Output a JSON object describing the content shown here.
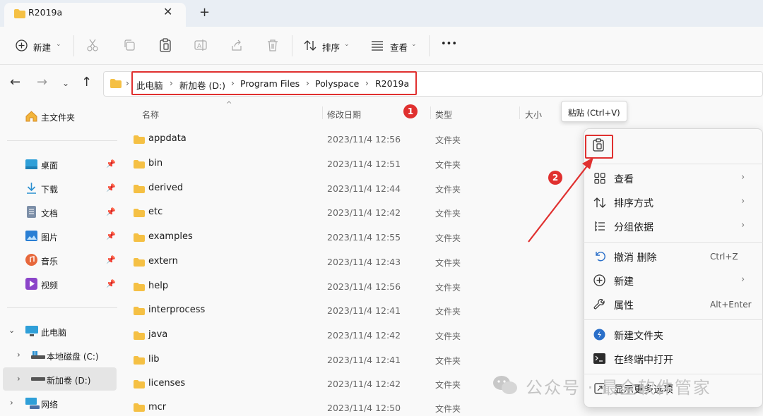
{
  "window": {
    "tab_title": "R2019a",
    "new_tab": "+",
    "close_tab": "✕"
  },
  "toolbar": {
    "new_label": "新建",
    "sort_label": "排序",
    "view_label": "查看",
    "more": "•••"
  },
  "breadcrumb": [
    "此电脑",
    "新加卷 (D:)",
    "Program Files",
    "Polyspace",
    "R2019a"
  ],
  "sidebar": {
    "home": "主文件夹",
    "quick": [
      {
        "label": "桌面",
        "icon": "desktop-icon"
      },
      {
        "label": "下载",
        "icon": "download-icon"
      },
      {
        "label": "文档",
        "icon": "document-icon"
      },
      {
        "label": "图片",
        "icon": "pictures-icon"
      },
      {
        "label": "音乐",
        "icon": "music-icon"
      },
      {
        "label": "视频",
        "icon": "video-icon"
      }
    ],
    "this_pc": "此电脑",
    "drives": [
      {
        "label": "本地磁盘 (C:)"
      },
      {
        "label": "新加卷 (D:)"
      }
    ],
    "network": "网络"
  },
  "columns": {
    "name": "名称",
    "date": "修改日期",
    "type": "类型",
    "size": "大小"
  },
  "files": [
    {
      "name": "appdata",
      "date": "2023/11/4 12:56",
      "type": "文件夹"
    },
    {
      "name": "bin",
      "date": "2023/11/4 12:51",
      "type": "文件夹"
    },
    {
      "name": "derived",
      "date": "2023/11/4 12:44",
      "type": "文件夹"
    },
    {
      "name": "etc",
      "date": "2023/11/4 12:42",
      "type": "文件夹"
    },
    {
      "name": "examples",
      "date": "2023/11/4 12:55",
      "type": "文件夹"
    },
    {
      "name": "extern",
      "date": "2023/11/4 12:43",
      "type": "文件夹"
    },
    {
      "name": "help",
      "date": "2023/11/4 12:56",
      "type": "文件夹"
    },
    {
      "name": "interprocess",
      "date": "2023/11/4 12:41",
      "type": "文件夹"
    },
    {
      "name": "java",
      "date": "2023/11/4 12:42",
      "type": "文件夹"
    },
    {
      "name": "lib",
      "date": "2023/11/4 12:41",
      "type": "文件夹"
    },
    {
      "name": "licenses",
      "date": "2023/11/4 12:42",
      "type": "文件夹"
    },
    {
      "name": "mcr",
      "date": "2023/11/4 12:50",
      "type": "文件夹"
    }
  ],
  "context_menu": {
    "tooltip": "粘贴 (Ctrl+V)",
    "items": [
      {
        "label": "查看",
        "icon": "grid-view-icon",
        "submenu": true
      },
      {
        "label": "排序方式",
        "icon": "sort-icon",
        "submenu": true
      },
      {
        "label": "分组依据",
        "icon": "group-icon",
        "submenu": true
      },
      {
        "label": "撤消 删除",
        "icon": "undo-icon",
        "shortcut": "Ctrl+Z"
      },
      {
        "label": "新建",
        "icon": "plus-circle-icon",
        "submenu": true
      },
      {
        "label": "属性",
        "icon": "wrench-icon",
        "shortcut": "Alt+Enter"
      },
      {
        "label": "新建文件夹",
        "icon": "new-folder-icon"
      },
      {
        "label": "在终端中打开",
        "icon": "terminal-icon"
      },
      {
        "label": "显示更多选项",
        "icon": "more-options-icon"
      }
    ],
    "arrow": "›"
  },
  "annotations": {
    "badge1": "1",
    "badge2": "2",
    "accent": "#e0302f"
  },
  "watermark": "公众号 · 最全软件管家"
}
